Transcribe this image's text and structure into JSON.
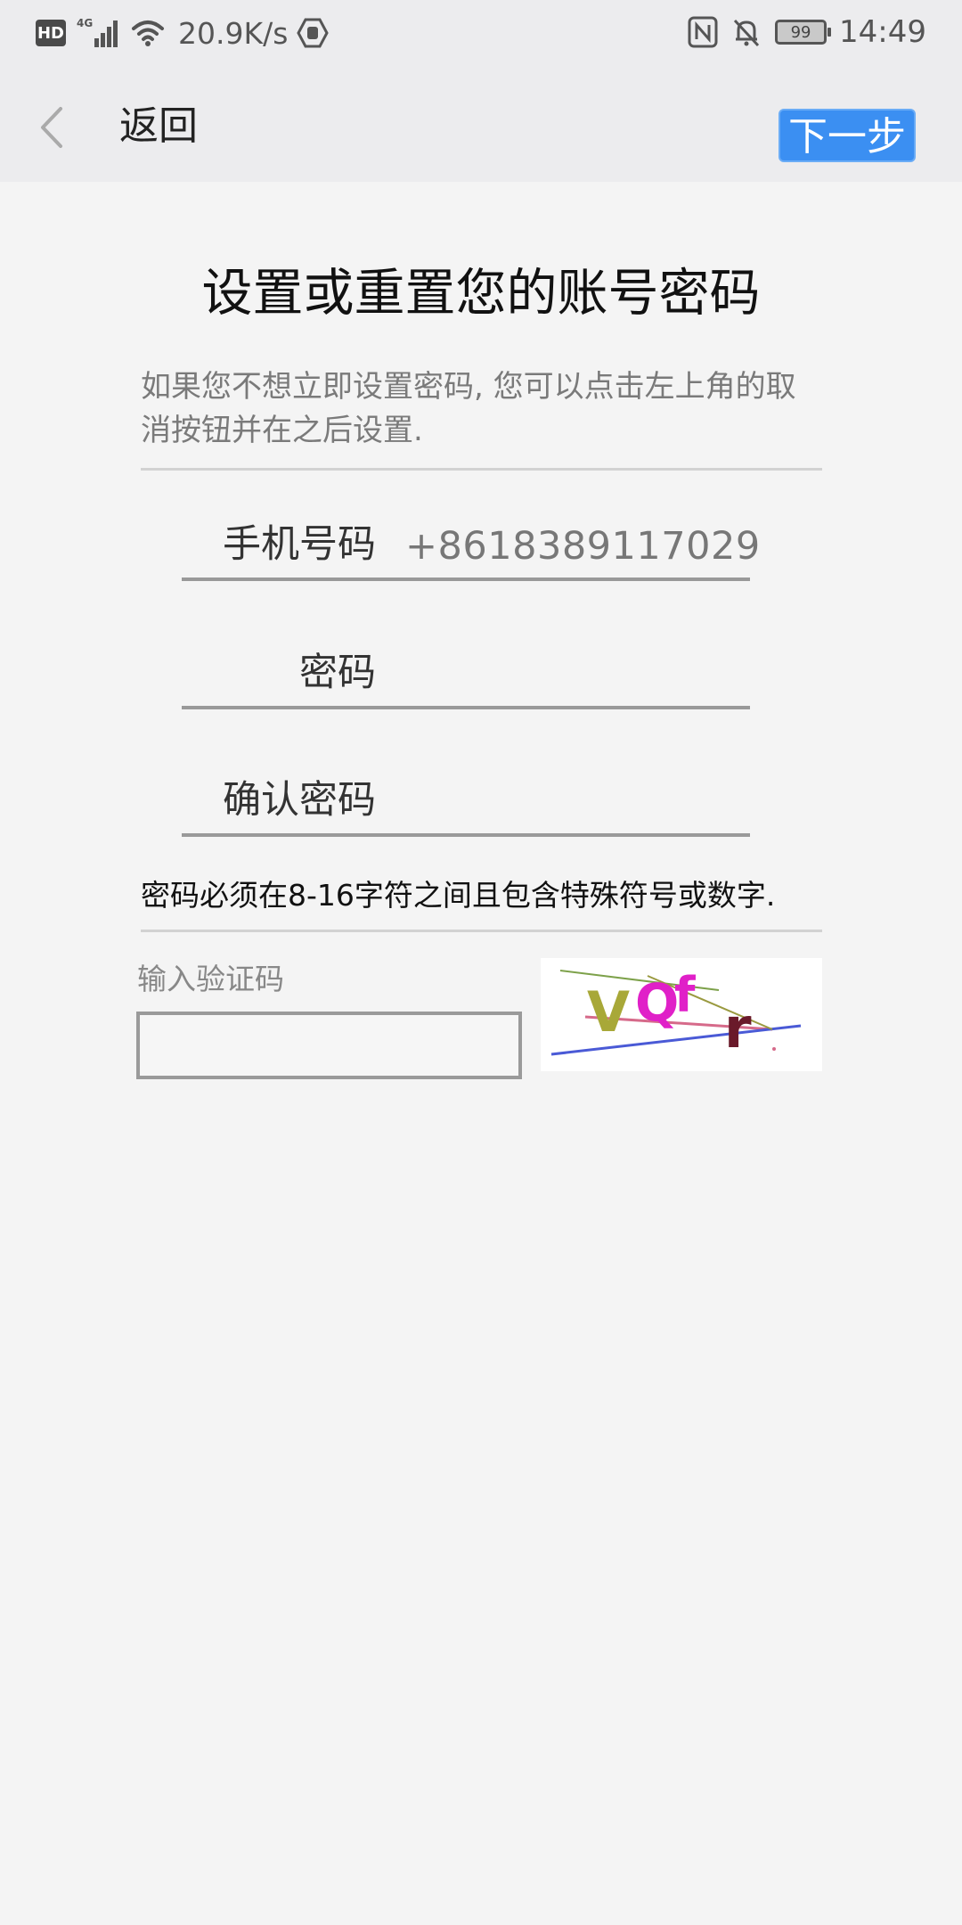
{
  "status_bar": {
    "network_type": "HD",
    "signal": "4G",
    "speed": "20.9K/s",
    "battery": "99",
    "time": "14:49"
  },
  "header": {
    "back_label": "返回",
    "next_label": "下一步"
  },
  "page": {
    "title": "设置或重置您的账号密码",
    "description": "如果您不想立即设置密码, 您可以点击左上角的取消按钮并在之后设置.",
    "fields": {
      "phone_label": "手机号码",
      "phone_value": "+8618389117029",
      "password_label": "密码",
      "confirm_label": "确认密码"
    },
    "hint": "密码必须在8-16字符之间且包含特殊符号或数字.",
    "captcha": {
      "label": "输入验证码",
      "input_value": "",
      "image_text": "VQfr"
    }
  },
  "colors": {
    "accent": "#3b8ff2",
    "background": "#f4f4f4",
    "header_bg": "#ececee"
  }
}
